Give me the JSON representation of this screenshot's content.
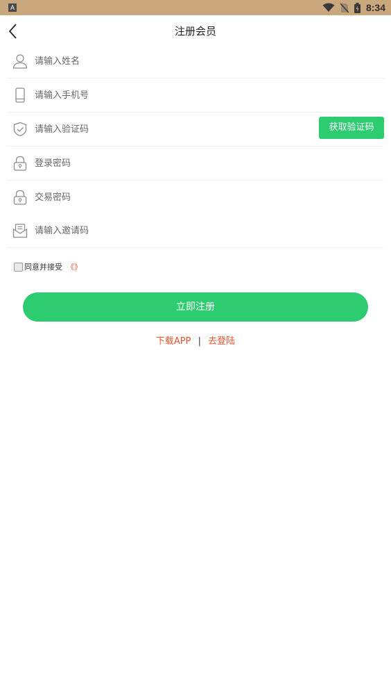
{
  "status_bar": {
    "left_icon": "A",
    "time": "8:34",
    "icons": [
      "wifi-icon",
      "no-sim-icon",
      "battery-icon"
    ]
  },
  "nav": {
    "title": "注册会员",
    "back_icon": "chevron-left-icon"
  },
  "form": {
    "name": {
      "placeholder": "请输入姓名",
      "icon": "user-icon"
    },
    "phone": {
      "placeholder": "请输入手机号",
      "icon": "phone-icon"
    },
    "code": {
      "placeholder": "请输入验证码",
      "icon": "shield-check-icon",
      "button": "获取验证码"
    },
    "login_password": {
      "placeholder": "登录密码",
      "icon": "lock-icon"
    },
    "trade_password": {
      "placeholder": "交易密码",
      "icon": "lock-icon"
    },
    "invite": {
      "placeholder": "请输入邀请码",
      "icon": "mail-icon"
    }
  },
  "agreement": {
    "text": "同意并接受",
    "link": "《》",
    "checked": false
  },
  "submit_label": "立即注册",
  "footer": {
    "download": "下载APP",
    "separator": "|",
    "login": "去登陆"
  },
  "colors": {
    "status_bar": "#c9a87d",
    "accent": "#2ecc71",
    "link": "#e8552d"
  }
}
